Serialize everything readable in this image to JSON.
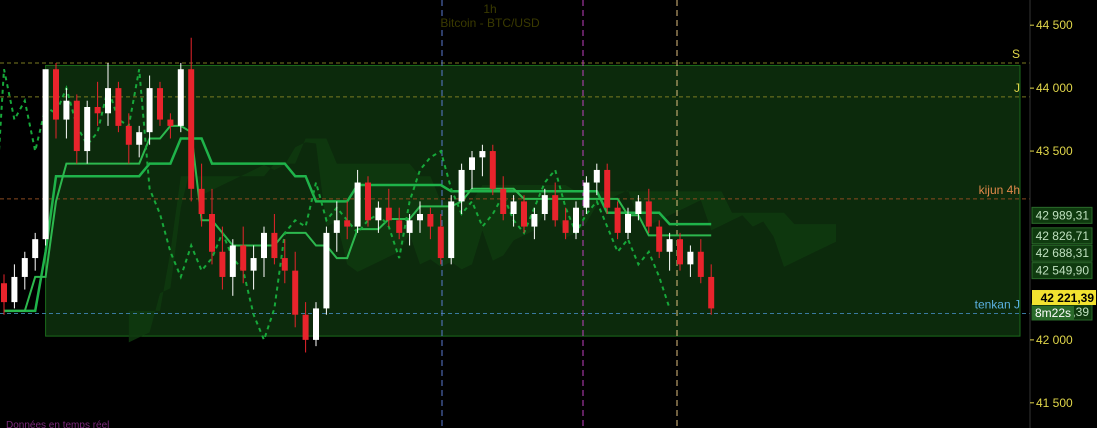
{
  "header": {
    "timeframe": "1h",
    "instrument": "Bitcoin - BTC/USD"
  },
  "footer": {
    "text": "Données en temps réel"
  },
  "colors": {
    "background": "#000000",
    "up": "#ffffff",
    "down": "#e8242c",
    "cloud_bull": "#0f3a0f",
    "cloud_bear": "#0a2a0a",
    "kijun": "#1fb34a",
    "tenkan": "#2db84e",
    "chikou": "#17a83a",
    "axis_text": "#e0d64a",
    "label_orange": "#e0894a",
    "label_blue": "#5ab0e0",
    "price_label_bg": "#f2e230"
  },
  "chart_data": {
    "type": "candlestick",
    "title": "Bitcoin - BTC/USD",
    "interval": "1h",
    "ylim": [
      41300,
      44700
    ],
    "y_ticks": [
      {
        "value": 44500,
        "label": "44 500"
      },
      {
        "value": 44000,
        "label": "44 000"
      },
      {
        "value": 43500,
        "label": "43 500"
      },
      {
        "value": 42000,
        "label": "42 000"
      },
      {
        "value": 41500,
        "label": "41 500"
      }
    ],
    "last_price": {
      "value": 42221.39,
      "label": "42 221,39"
    },
    "countdown": "8m22s",
    "level_labels": [
      {
        "value": 42989.31,
        "label": "42 989,31"
      },
      {
        "value": 42826.71,
        "label": "42 826,71"
      },
      {
        "value": 42688.31,
        "label": "42 688,31"
      },
      {
        "value": 42549.9,
        "label": "42 549,90"
      },
      {
        "value": 42221.39,
        "label": "42 221,39"
      }
    ],
    "horizontal_lines": [
      {
        "name": "S",
        "value": 44200,
        "style": "dashed"
      },
      {
        "name": "J",
        "value": 43930,
        "style": "dashed"
      },
      {
        "name": "kijun 4h",
        "value": 43120,
        "style": "dashed"
      },
      {
        "name": "tenkan J",
        "value": 42210,
        "style": "dashed"
      }
    ],
    "zones": [
      {
        "from": 42030,
        "to": 44180
      }
    ],
    "candles": [
      [
        42450,
        42520,
        42200,
        42300
      ],
      [
        42300,
        42600,
        42250,
        42500
      ],
      [
        42500,
        42700,
        42400,
        42650
      ],
      [
        42650,
        42850,
        42550,
        42800
      ],
      [
        42800,
        44100,
        42750,
        44150
      ],
      [
        44150,
        44200,
        43600,
        43750
      ],
      [
        43750,
        44000,
        43600,
        43900
      ],
      [
        43900,
        43950,
        43400,
        43500
      ],
      [
        43500,
        43900,
        43400,
        43850
      ],
      [
        43850,
        44050,
        43700,
        43800
      ],
      [
        43800,
        44200,
        43700,
        44000
      ],
      [
        44000,
        44050,
        43650,
        43700
      ],
      [
        43700,
        43800,
        43400,
        43550
      ],
      [
        43550,
        43700,
        43450,
        43650
      ],
      [
        43650,
        44100,
        43550,
        44000
      ],
      [
        44000,
        44050,
        43700,
        43750
      ],
      [
        43750,
        43800,
        43600,
        43700
      ],
      [
        43700,
        44200,
        43650,
        44150
      ],
      [
        44150,
        44400,
        43100,
        43200
      ],
      [
        43200,
        43400,
        42900,
        43000
      ],
      [
        43000,
        43200,
        42600,
        42700
      ],
      [
        42700,
        42900,
        42400,
        42500
      ],
      [
        42500,
        42800,
        42350,
        42750
      ],
      [
        42750,
        42900,
        42450,
        42550
      ],
      [
        42550,
        42750,
        42400,
        42650
      ],
      [
        42650,
        42900,
        42500,
        42850
      ],
      [
        42850,
        43000,
        42600,
        42650
      ],
      [
        42650,
        42800,
        42450,
        42550
      ],
      [
        42550,
        42700,
        42100,
        42200
      ],
      [
        42200,
        42300,
        41900,
        42000
      ],
      [
        42000,
        42300,
        41950,
        42250
      ],
      [
        42250,
        42900,
        42200,
        42850
      ],
      [
        42850,
        43100,
        42700,
        42950
      ],
      [
        42950,
        43100,
        42800,
        42900
      ],
      [
        42900,
        43350,
        42850,
        43250
      ],
      [
        43250,
        43300,
        42900,
        42950
      ],
      [
        42950,
        43100,
        42850,
        43050
      ],
      [
        43050,
        43200,
        42900,
        42950
      ],
      [
        42950,
        43050,
        42800,
        42850
      ],
      [
        42850,
        43000,
        42750,
        42950
      ],
      [
        42950,
        43100,
        42850,
        43000
      ],
      [
        43000,
        43050,
        42800,
        42900
      ],
      [
        42900,
        43000,
        42600,
        42650
      ],
      [
        42650,
        43150,
        42600,
        43100
      ],
      [
        43100,
        43400,
        43000,
        43350
      ],
      [
        43350,
        43500,
        43200,
        43450
      ],
      [
        43450,
        43550,
        43300,
        43500
      ],
      [
        43500,
        43550,
        43150,
        43200
      ],
      [
        43200,
        43300,
        42950,
        43000
      ],
      [
        43000,
        43150,
        42900,
        43100
      ],
      [
        43100,
        43150,
        42850,
        42900
      ],
      [
        42900,
        43050,
        42800,
        43000
      ],
      [
        43000,
        43200,
        42950,
        43150
      ],
      [
        43150,
        43250,
        42900,
        42950
      ],
      [
        42950,
        43050,
        42800,
        42850
      ],
      [
        42850,
        43100,
        42800,
        43050
      ],
      [
        43050,
        43300,
        43000,
        43250
      ],
      [
        43250,
        43400,
        43150,
        43350
      ],
      [
        43350,
        43400,
        43000,
        43050
      ],
      [
        43050,
        43100,
        42800,
        42850
      ],
      [
        42850,
        43050,
        42800,
        43000
      ],
      [
        43000,
        43150,
        42950,
        43100
      ],
      [
        43100,
        43200,
        42850,
        42900
      ],
      [
        42900,
        42950,
        42650,
        42700
      ],
      [
        42700,
        42850,
        42550,
        42800
      ],
      [
        42800,
        42850,
        42550,
        42600
      ],
      [
        42600,
        42750,
        42500,
        42700
      ],
      [
        42700,
        42800,
        42450,
        42500
      ],
      [
        42500,
        42600,
        42200,
        42250
      ]
    ],
    "kijun": [
      42230,
      42230,
      42230,
      42230,
      42700,
      43300,
      43300,
      43300,
      43300,
      43300,
      43300,
      43300,
      43300,
      43300,
      43400,
      43400,
      43400,
      43600,
      43600,
      43600,
      43400,
      43400,
      43400,
      43400,
      43400,
      43400,
      43400,
      43400,
      43300,
      43300,
      43100,
      43100,
      43100,
      43100,
      43230,
      43230,
      43230,
      43230,
      43230,
      43230,
      43230,
      43230,
      43230,
      43180,
      43180,
      43180,
      43180,
      43180,
      43180,
      43180,
      43180,
      43180,
      43180,
      43180,
      43180,
      43180,
      43180,
      43180,
      43010,
      43010,
      43010,
      43010,
      43010,
      43010,
      42920,
      42920,
      42920,
      42920,
      42920
    ],
    "tenkan": [
      42230,
      42230,
      42230,
      42500,
      42500,
      43100,
      43400,
      43400,
      43400,
      43400,
      43400,
      43400,
      43400,
      43400,
      43600,
      43600,
      43700,
      43700,
      43650,
      42950,
      42950,
      42850,
      42750,
      42750,
      42750,
      42750,
      42750,
      42850,
      42850,
      42850,
      42750,
      42750,
      42650,
      42650,
      42880,
      42880,
      42880,
      42960,
      42960,
      42960,
      43060,
      43060,
      43060,
      43060,
      43100,
      43200,
      43200,
      43200,
      43200,
      43200,
      43120,
      43120,
      43120,
      43120,
      43120,
      43120,
      43120,
      43120,
      43120,
      43120,
      42990,
      42990,
      42830,
      42830,
      42830,
      42830,
      42830,
      42830,
      42830
    ]
  }
}
